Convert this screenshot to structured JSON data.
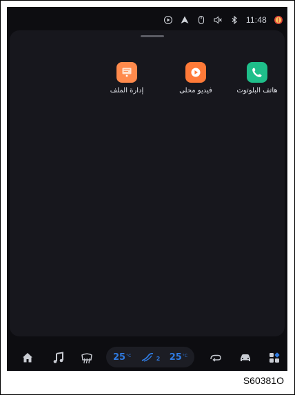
{
  "status_bar": {
    "time": "11:48",
    "icons": [
      "record-icon",
      "navigation-icon",
      "mouse-icon",
      "volume-off-icon",
      "bluetooth-icon",
      "profile-icon"
    ]
  },
  "apps": [
    {
      "label": "هاتف البلوتوث",
      "icon": "phone-icon",
      "color": "#1fbf8a"
    },
    {
      "label": "فيديو محلى",
      "icon": "play-icon",
      "color": "#ff7a38"
    },
    {
      "label": "إدارة الملف",
      "icon": "file-icon",
      "color": "#ff8a4c"
    }
  ],
  "dock": {
    "items": [
      "home-icon",
      "music-icon",
      "rear-defrost-icon",
      "recirculation-icon",
      "car-icon",
      "apps-grid-icon"
    ],
    "climate": {
      "left_temp": "25",
      "right_temp": "25",
      "unit": "°C",
      "fan_level": "2",
      "accent_color": "#2f7ae0"
    }
  },
  "figure_code": "S60381O"
}
